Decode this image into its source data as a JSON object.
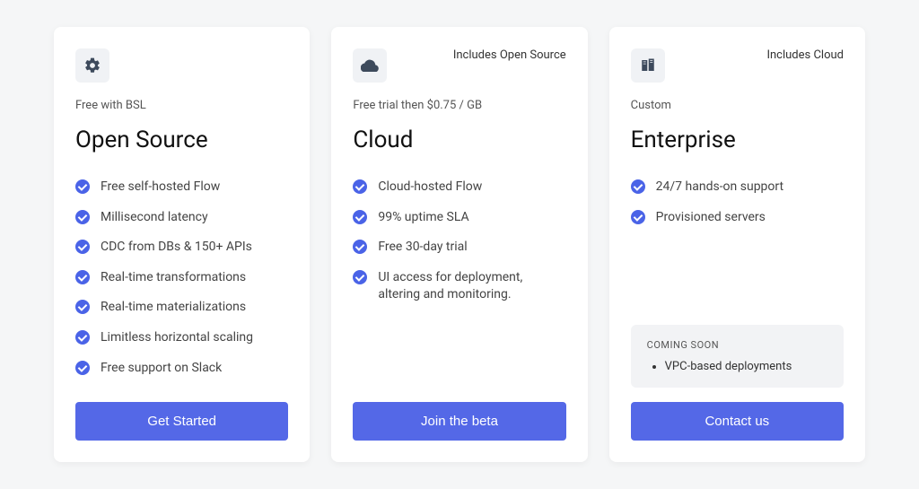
{
  "plans": [
    {
      "icon": "gear-icon",
      "header_tag": "",
      "price_note": "Free with BSL",
      "title": "Open Source",
      "features": [
        "Free self-hosted Flow",
        "Millisecond latency",
        "CDC from DBs & 150+ APIs",
        "Real-time transformations",
        "Real-time materializations",
        "Limitless horizontal scaling",
        "Free support on Slack"
      ],
      "cta": "Get Started"
    },
    {
      "icon": "cloud-icon",
      "header_tag": "Includes Open Source",
      "price_note": "Free trial then $0.75 / GB",
      "title": "Cloud",
      "features": [
        "Cloud-hosted Flow",
        "99% uptime SLA",
        "Free 30-day trial",
        "UI access for deployment, altering and monitoring."
      ],
      "cta": "Join the beta"
    },
    {
      "icon": "server-icon",
      "header_tag": "Includes Cloud",
      "price_note": "Custom",
      "title": "Enterprise",
      "features": [
        "24/7 hands-on support",
        "Provisioned servers"
      ],
      "coming_soon": {
        "label": "COMING SOON",
        "items": [
          "VPC-based deployments"
        ]
      },
      "cta": "Contact us"
    }
  ]
}
